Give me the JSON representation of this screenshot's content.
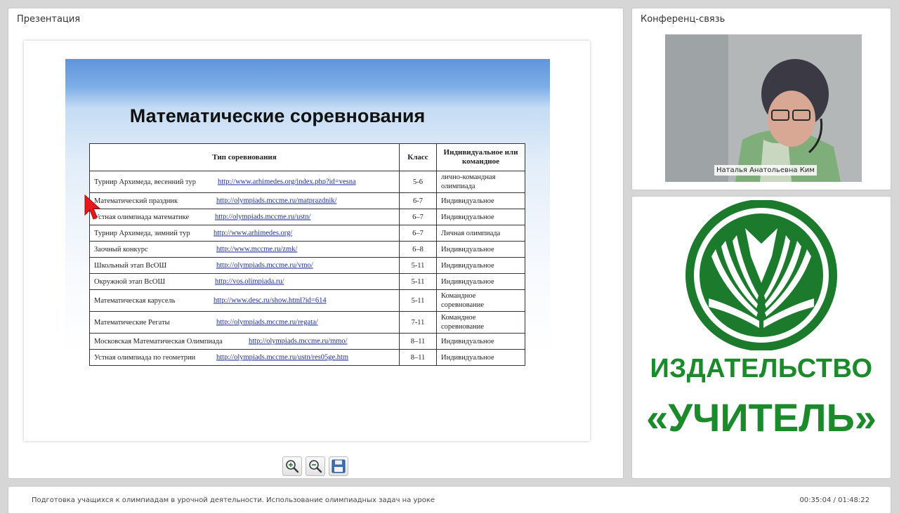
{
  "presentation": {
    "title": "Презентация",
    "slide": {
      "title": "Математические соревнования",
      "headers": [
        "Тип соревнования",
        "Класс",
        "Индивидуальное или командное"
      ],
      "rows": [
        {
          "name": "Турнир Архимеда, весенний тур",
          "url": "http://www.arhimedes.org/index.php?id=vesna",
          "grade": "5-6",
          "mode": "лично-командная олимпиада"
        },
        {
          "name": "Математический  праздник",
          "url": "http://olympiads.mccme.ru/matprazdnik/",
          "grade": "6-7",
          "mode": "Индивидуальное"
        },
        {
          "name": "Устная олимпиада математике",
          "url": "http://olympiads.mccme.ru/ustn/",
          "grade": "6–7",
          "mode": "Индивидуальное"
        },
        {
          "name": "Турнир Архимеда, зимний тур",
          "url": "http://www.arhimedes.org/",
          "grade": "6–7",
          "mode": "Личная олимпиада"
        },
        {
          "name": "Заочный конкурс",
          "url": "http://www.mccme.ru/zmk/",
          "grade": "6–8",
          "mode": "Индивидуальное"
        },
        {
          "name": "Школьный этап ВсОШ",
          "url": "http://olympiads.mccme.ru/vmo/",
          "grade": "5-11",
          "mode": "Индивидуальное"
        },
        {
          "name": "Окружной этап ВсОШ",
          "url": "http://vos.olimpiada.ru/",
          "grade": "5-11",
          "mode": "Индивидуальное"
        },
        {
          "name": "Математическая карусель",
          "url": "http://www.desc.ru/show.html?id=614",
          "grade": "5-11",
          "mode": "Командное соревнование"
        },
        {
          "name": "Математические Регаты",
          "url": "http://olympiads.mccme.ru/regata/",
          "grade": "7-11",
          "mode": "Командное соревнование"
        },
        {
          "name": "Московская Математическая Олимпиада",
          "url": "http://olympiads.mccme.ru/mmo/",
          "grade": "8–11",
          "mode": "Индивидуальное"
        },
        {
          "name": "Устная  олимпиада по геометрии",
          "url": "http://olympiads.mccme.ru/ustn/res05ge.htm",
          "grade": "8–11",
          "mode": "Индивидуальное"
        }
      ]
    },
    "toolbar": {
      "zoom_in_icon": "magnifier-plus-icon",
      "zoom_out_icon": "magnifier-minus-icon",
      "save_icon": "floppy-disk-icon"
    }
  },
  "conference": {
    "title": "Конференц-связь",
    "participant_name": "Наталья Анатольевна Ким"
  },
  "logo": {
    "line1": "ИЗДАТЕЛЬСТВО",
    "line2": "«УЧИТЕЛЬ»",
    "color": "#1b8a2b"
  },
  "footer": {
    "course_title": "Подготовка учащихся к олимпиадам в урочной деятельности. Использование олимпиадных задач на уроке",
    "timer": "00:35:04 / 01:48:22"
  }
}
